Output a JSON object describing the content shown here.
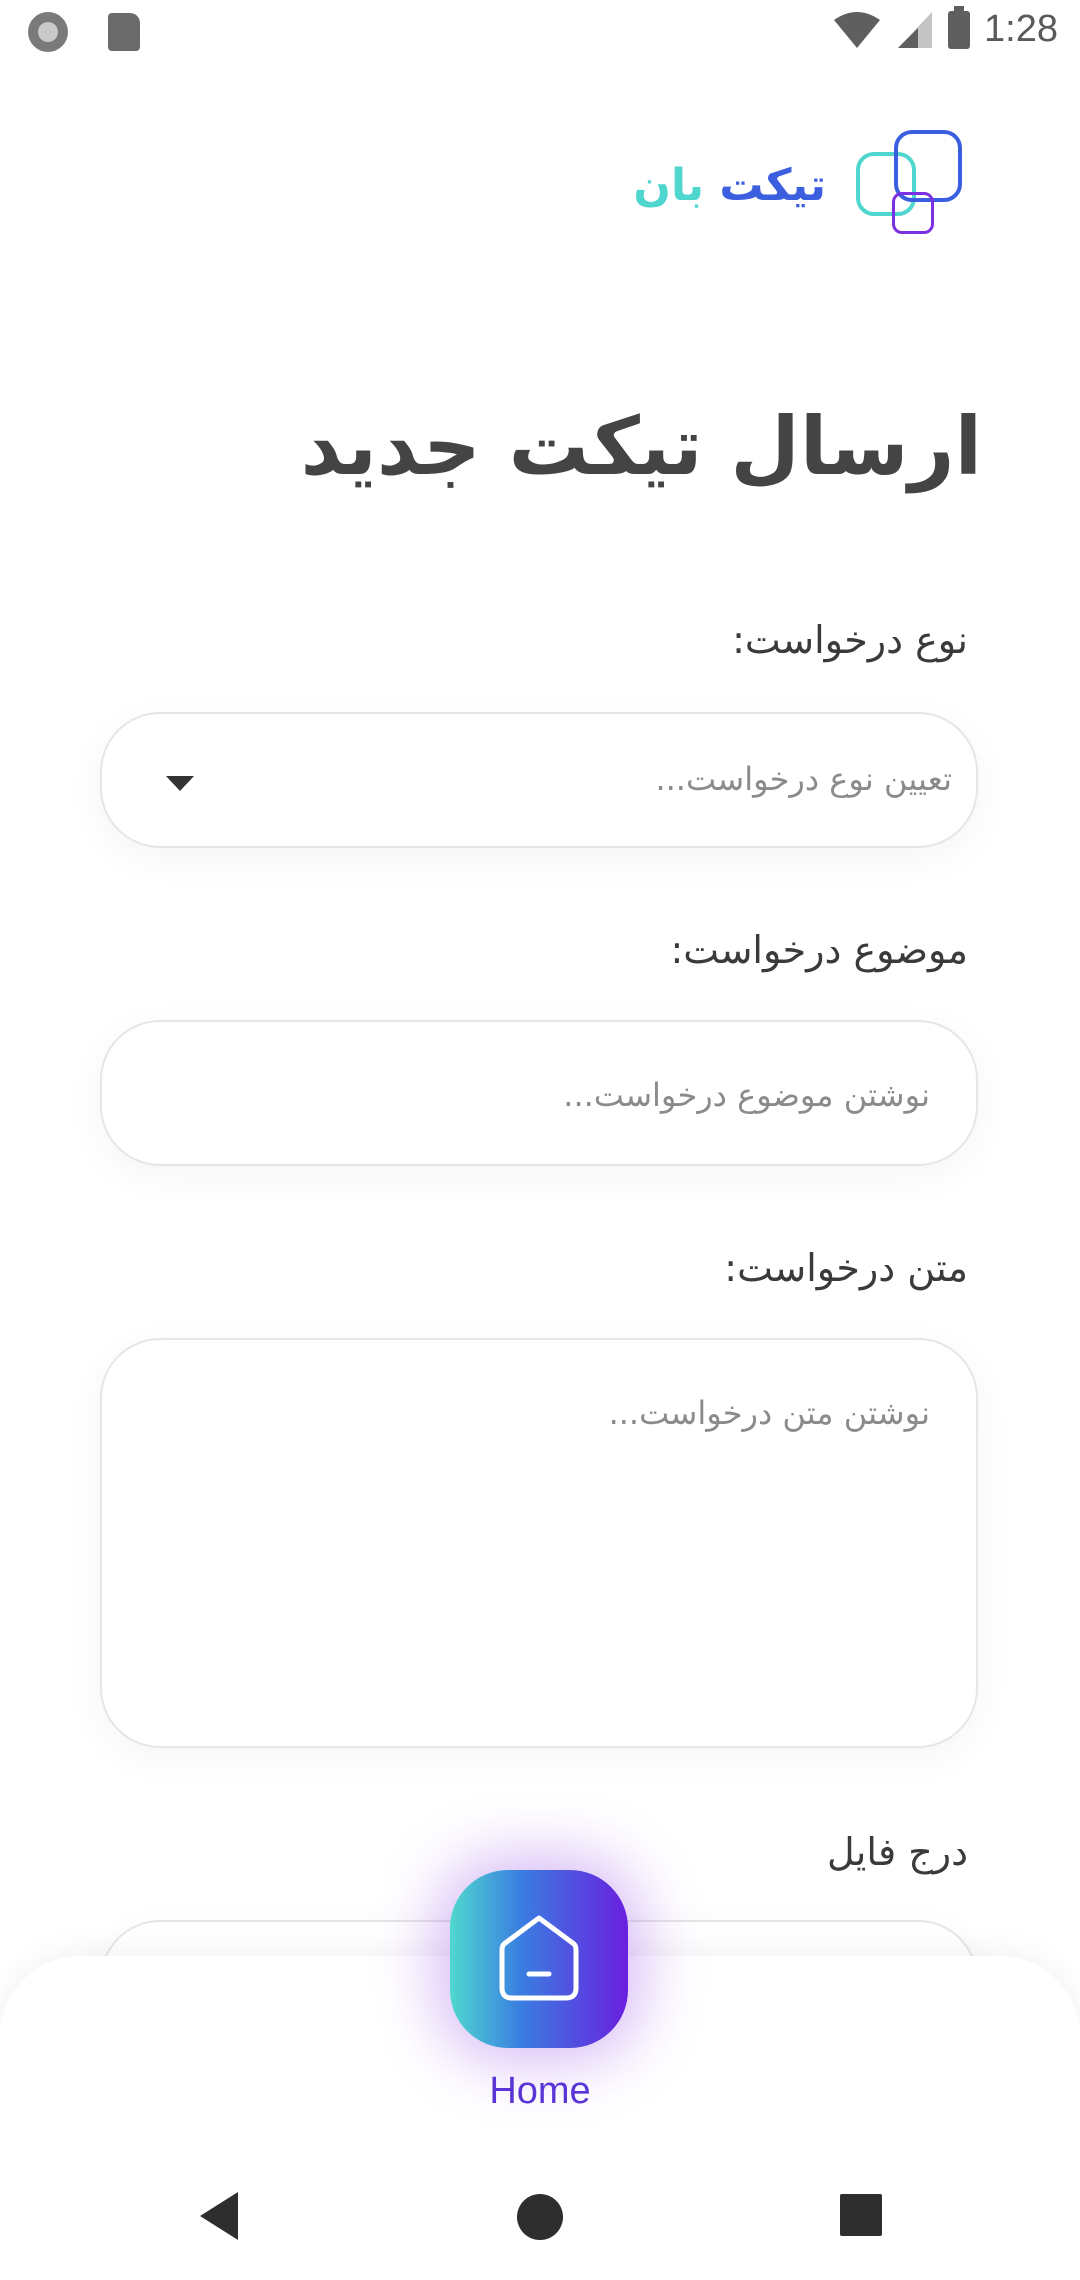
{
  "status_bar": {
    "time": "1:28",
    "left_icons": [
      "record-icon",
      "sd-card-icon"
    ],
    "right_icons": [
      "wifi-icon",
      "signal-icon",
      "battery-icon"
    ]
  },
  "logo": {
    "word1": "تیکت",
    "word2": "بان",
    "colors": {
      "blue": "#3c5fe0",
      "teal": "#4fd6cf",
      "purple": "#7a2fe0"
    }
  },
  "page": {
    "title": "ارسال تیکت جدید"
  },
  "form": {
    "type": {
      "label": "نوع درخواست:",
      "placeholder": "تعیین نوع درخواست..."
    },
    "subject": {
      "label": "موضوع درخواست:",
      "placeholder": "نوشتن موضوع درخواست..."
    },
    "body": {
      "label": "متن درخواست:",
      "placeholder": "نوشتن متن درخواست..."
    },
    "file": {
      "label": "درج فایل"
    }
  },
  "bottom_nav": {
    "home_label": "Home",
    "accent": "#5a35d6"
  }
}
